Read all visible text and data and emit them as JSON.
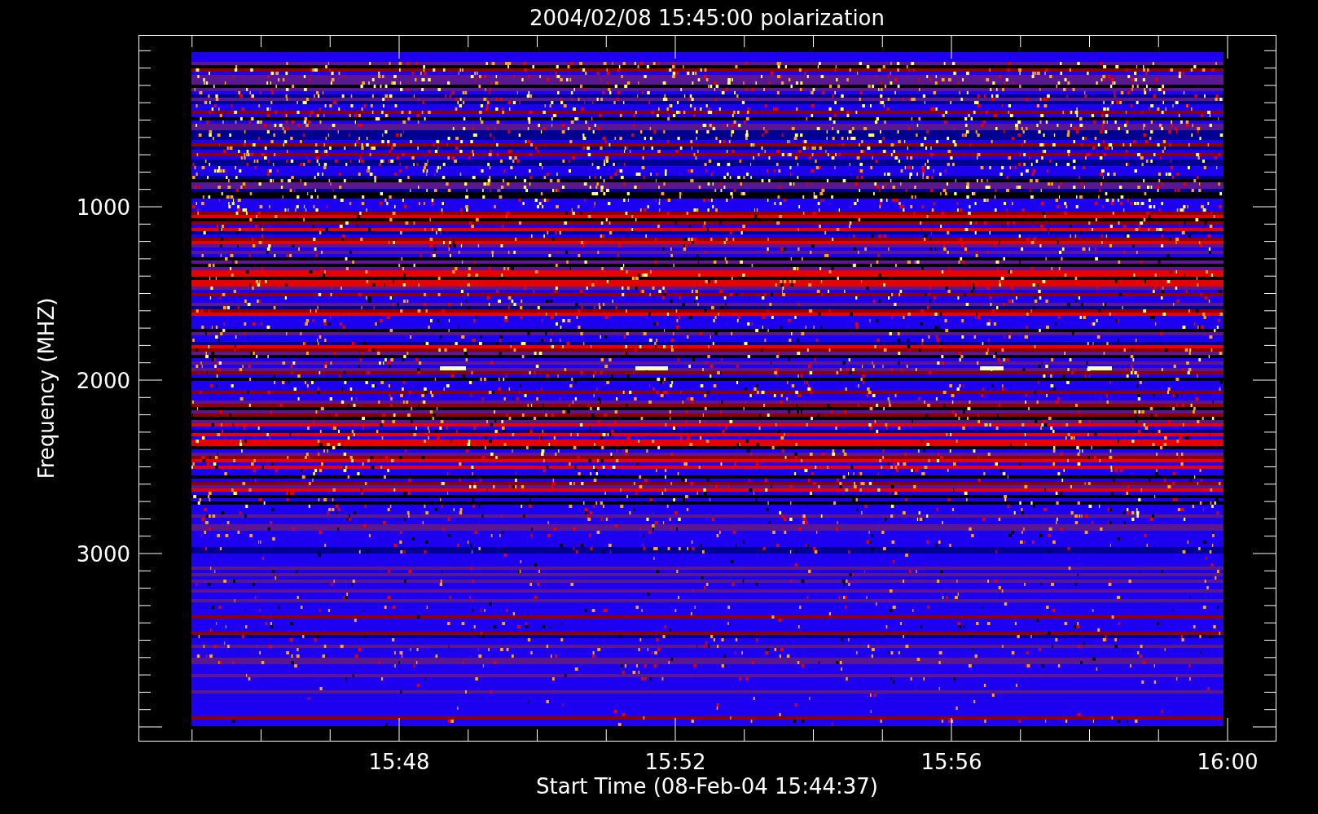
{
  "title": "2004/02/08 15:45:00 polarization",
  "ylabel": "Frequency (MHZ)",
  "xlabel": "Start Time (08-Feb-04 15:44:37)",
  "y_tick_labels": [
    "1000",
    "2000",
    "3000"
  ],
  "x_tick_labels": [
    "15:48",
    "15:52",
    "15:56",
    "16:00"
  ]
}
